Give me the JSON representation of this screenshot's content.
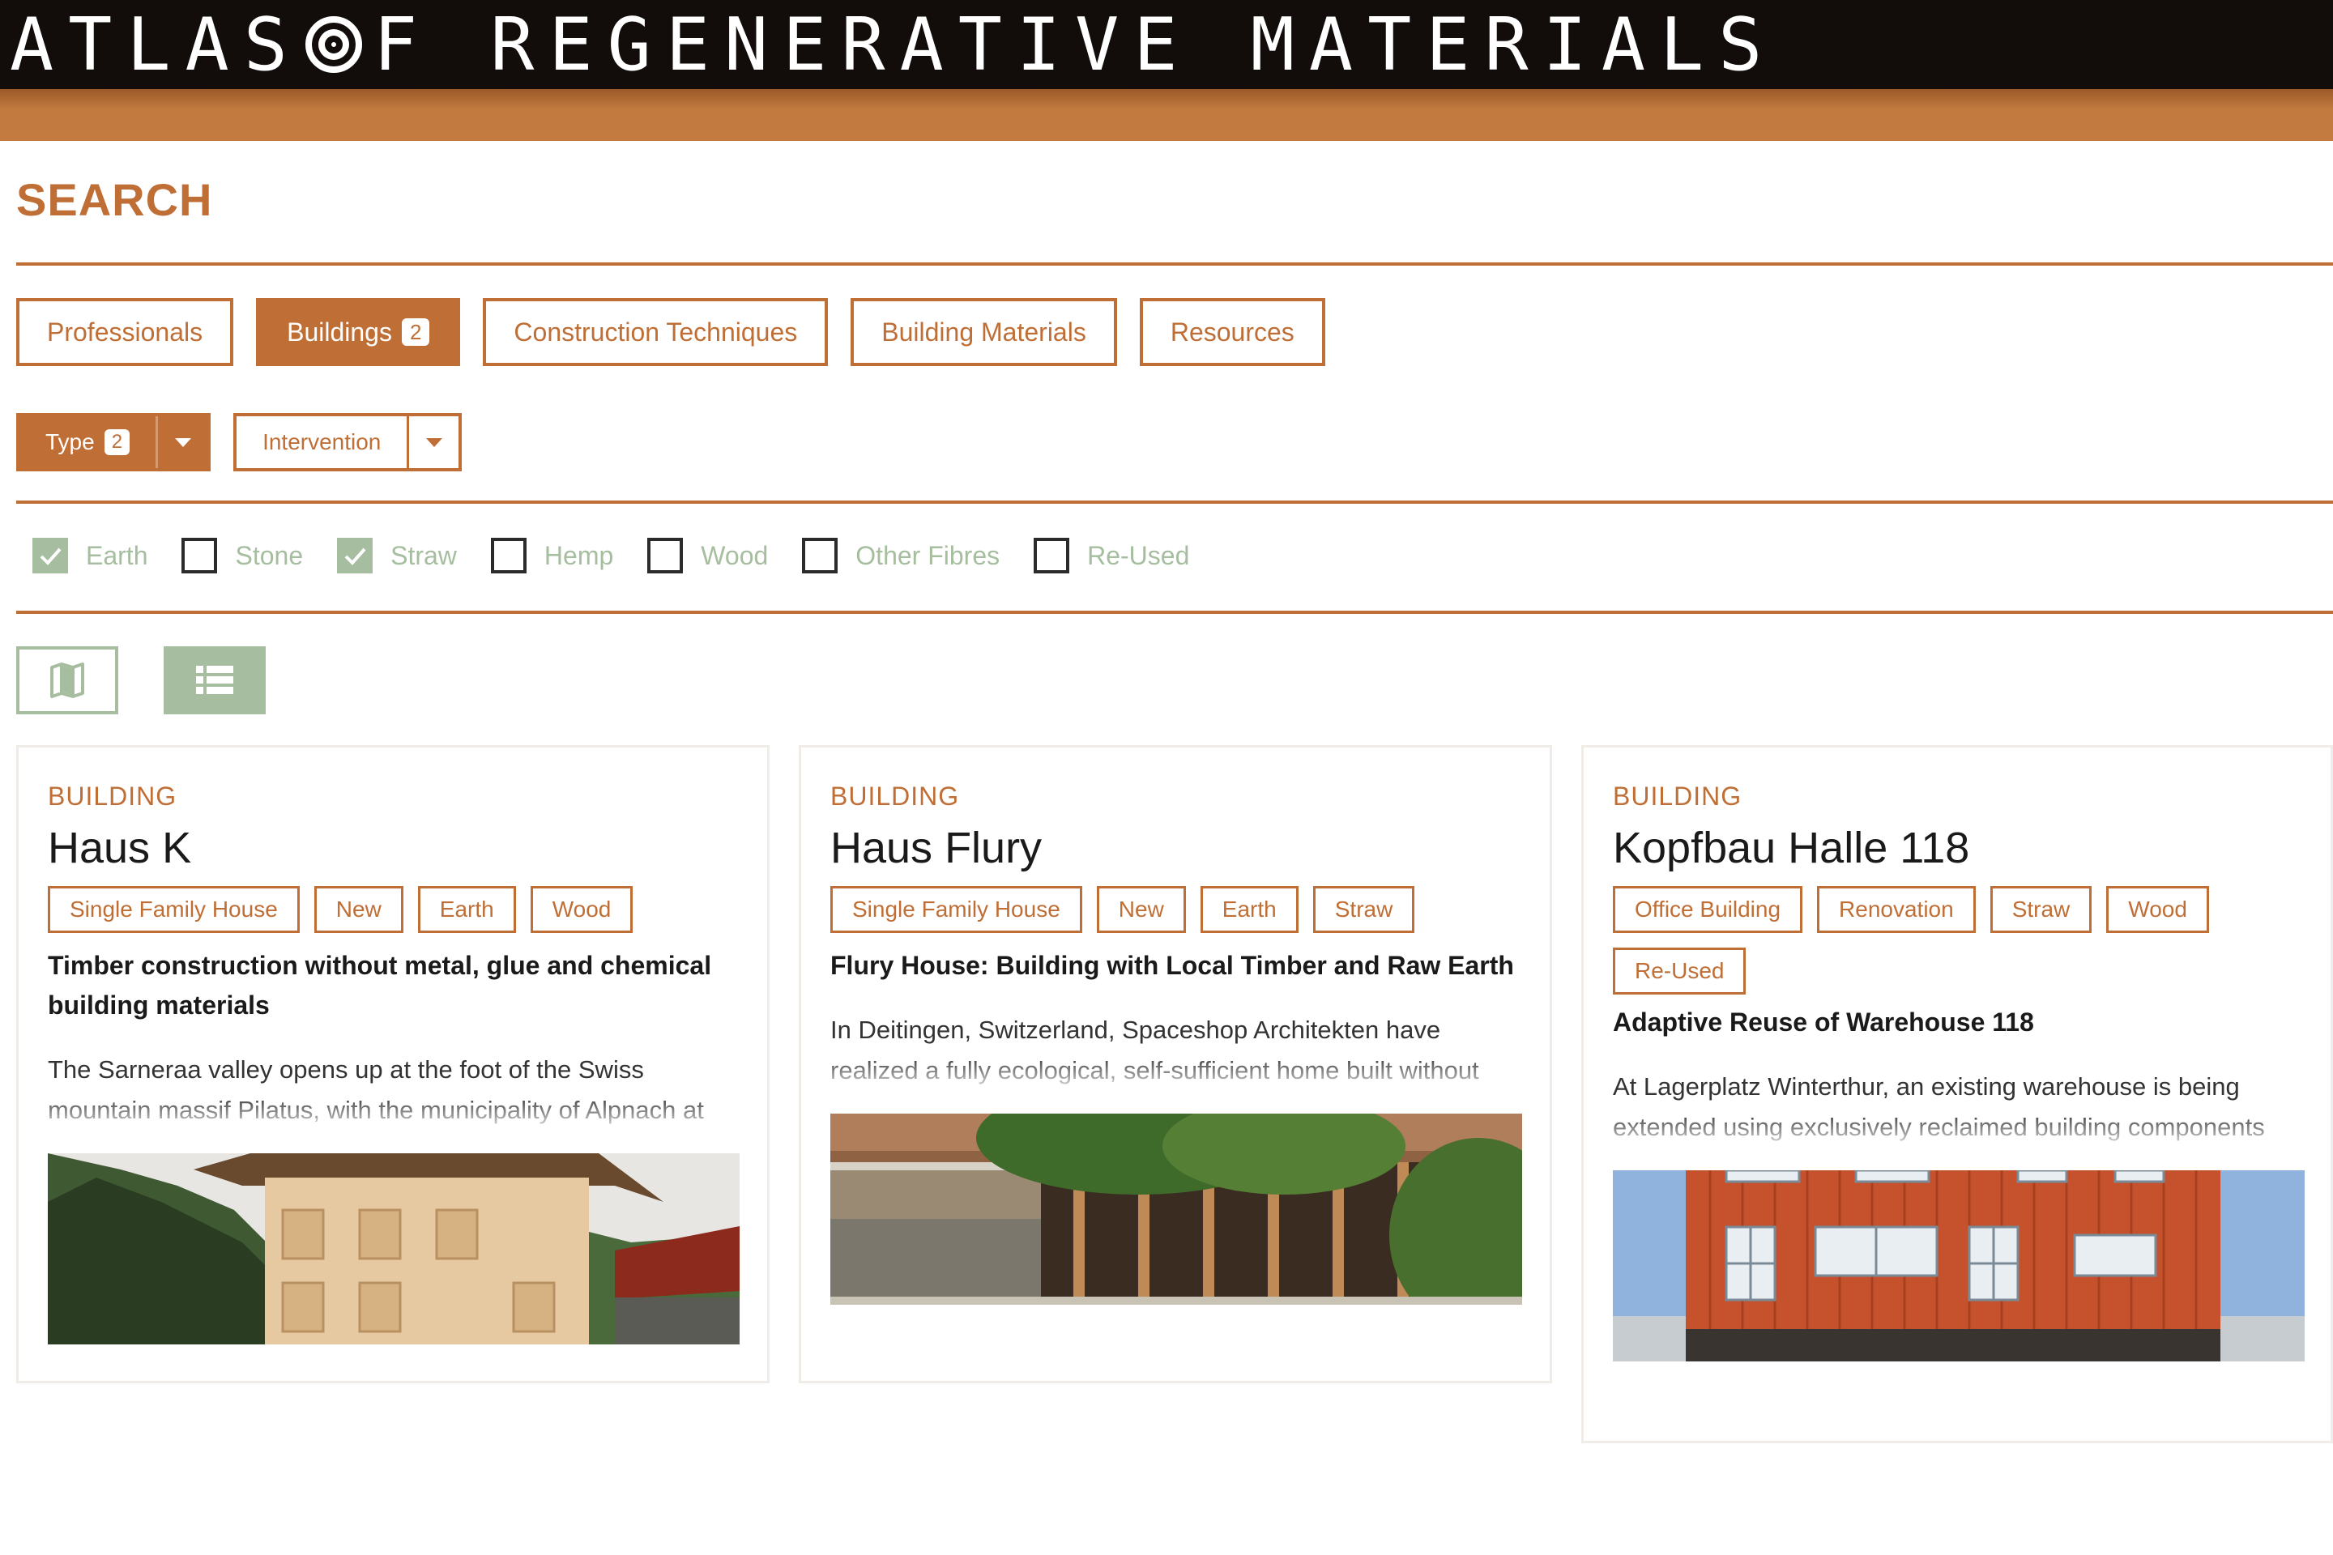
{
  "header": {
    "logo_text": "ATLAS OF REGENERATIVE MATERIALS",
    "logo_left": "ATLAS",
    "logo_right": "F REGENERATIVE MATERIALS",
    "brand_colors": {
      "dark": "#120d0a",
      "accent": "#bf6e35",
      "green": "#a6be9f"
    }
  },
  "page": {
    "title": "SEARCH"
  },
  "tabs": [
    {
      "label": "Professionals"
    },
    {
      "label": "Buildings",
      "count": "2",
      "active": true
    },
    {
      "label": "Construction Techniques"
    },
    {
      "label": "Building Materials"
    },
    {
      "label": "Resources"
    }
  ],
  "filters": {
    "type": {
      "label": "Type",
      "count": "2"
    },
    "intervention": {
      "label": "Intervention"
    }
  },
  "materials": [
    {
      "label": "Earth",
      "checked": true
    },
    {
      "label": "Stone",
      "checked": false
    },
    {
      "label": "Straw",
      "checked": true
    },
    {
      "label": "Hemp",
      "checked": false
    },
    {
      "label": "Wood",
      "checked": false
    },
    {
      "label": "Other Fibres",
      "checked": false
    },
    {
      "label": "Re-Used",
      "checked": false
    }
  ],
  "views": {
    "map_icon": "map-icon",
    "list_icon": "list-icon",
    "active": "list"
  },
  "cards": [
    {
      "kind": "BUILDING",
      "name": "Haus K",
      "tags": [
        "Single Family House",
        "New",
        "Earth",
        "Wood"
      ],
      "subtitle": "Timber construction without metal, glue and chemical building materials",
      "description": "The Sarneraa valley opens up at the foot of the Swiss mountain massif Pilatus, with the municipality of Alpnach at"
    },
    {
      "kind": "BUILDING",
      "name": "Haus Flury",
      "tags": [
        "Single Family House",
        "New",
        "Earth",
        "Straw"
      ],
      "subtitle": "Flury House: Building with Local Timber and Raw Earth",
      "description": "In Deitingen, Switzerland, Spaceshop Architekten have realized a fully ecological, self-sufficient home built without concrete, using loam walls and a straw bale roof."
    },
    {
      "kind": "BUILDING",
      "name": "Kopfbau Halle 118",
      "tags": [
        "Office Building",
        "Renovation",
        "Straw",
        "Wood",
        "Re-Used"
      ],
      "subtitle": "Adaptive Reuse of Warehouse 118",
      "description": "At Lagerplatz Winterthur, an existing warehouse is being extended using exclusively reclaimed building components from deconstructed structures."
    }
  ]
}
